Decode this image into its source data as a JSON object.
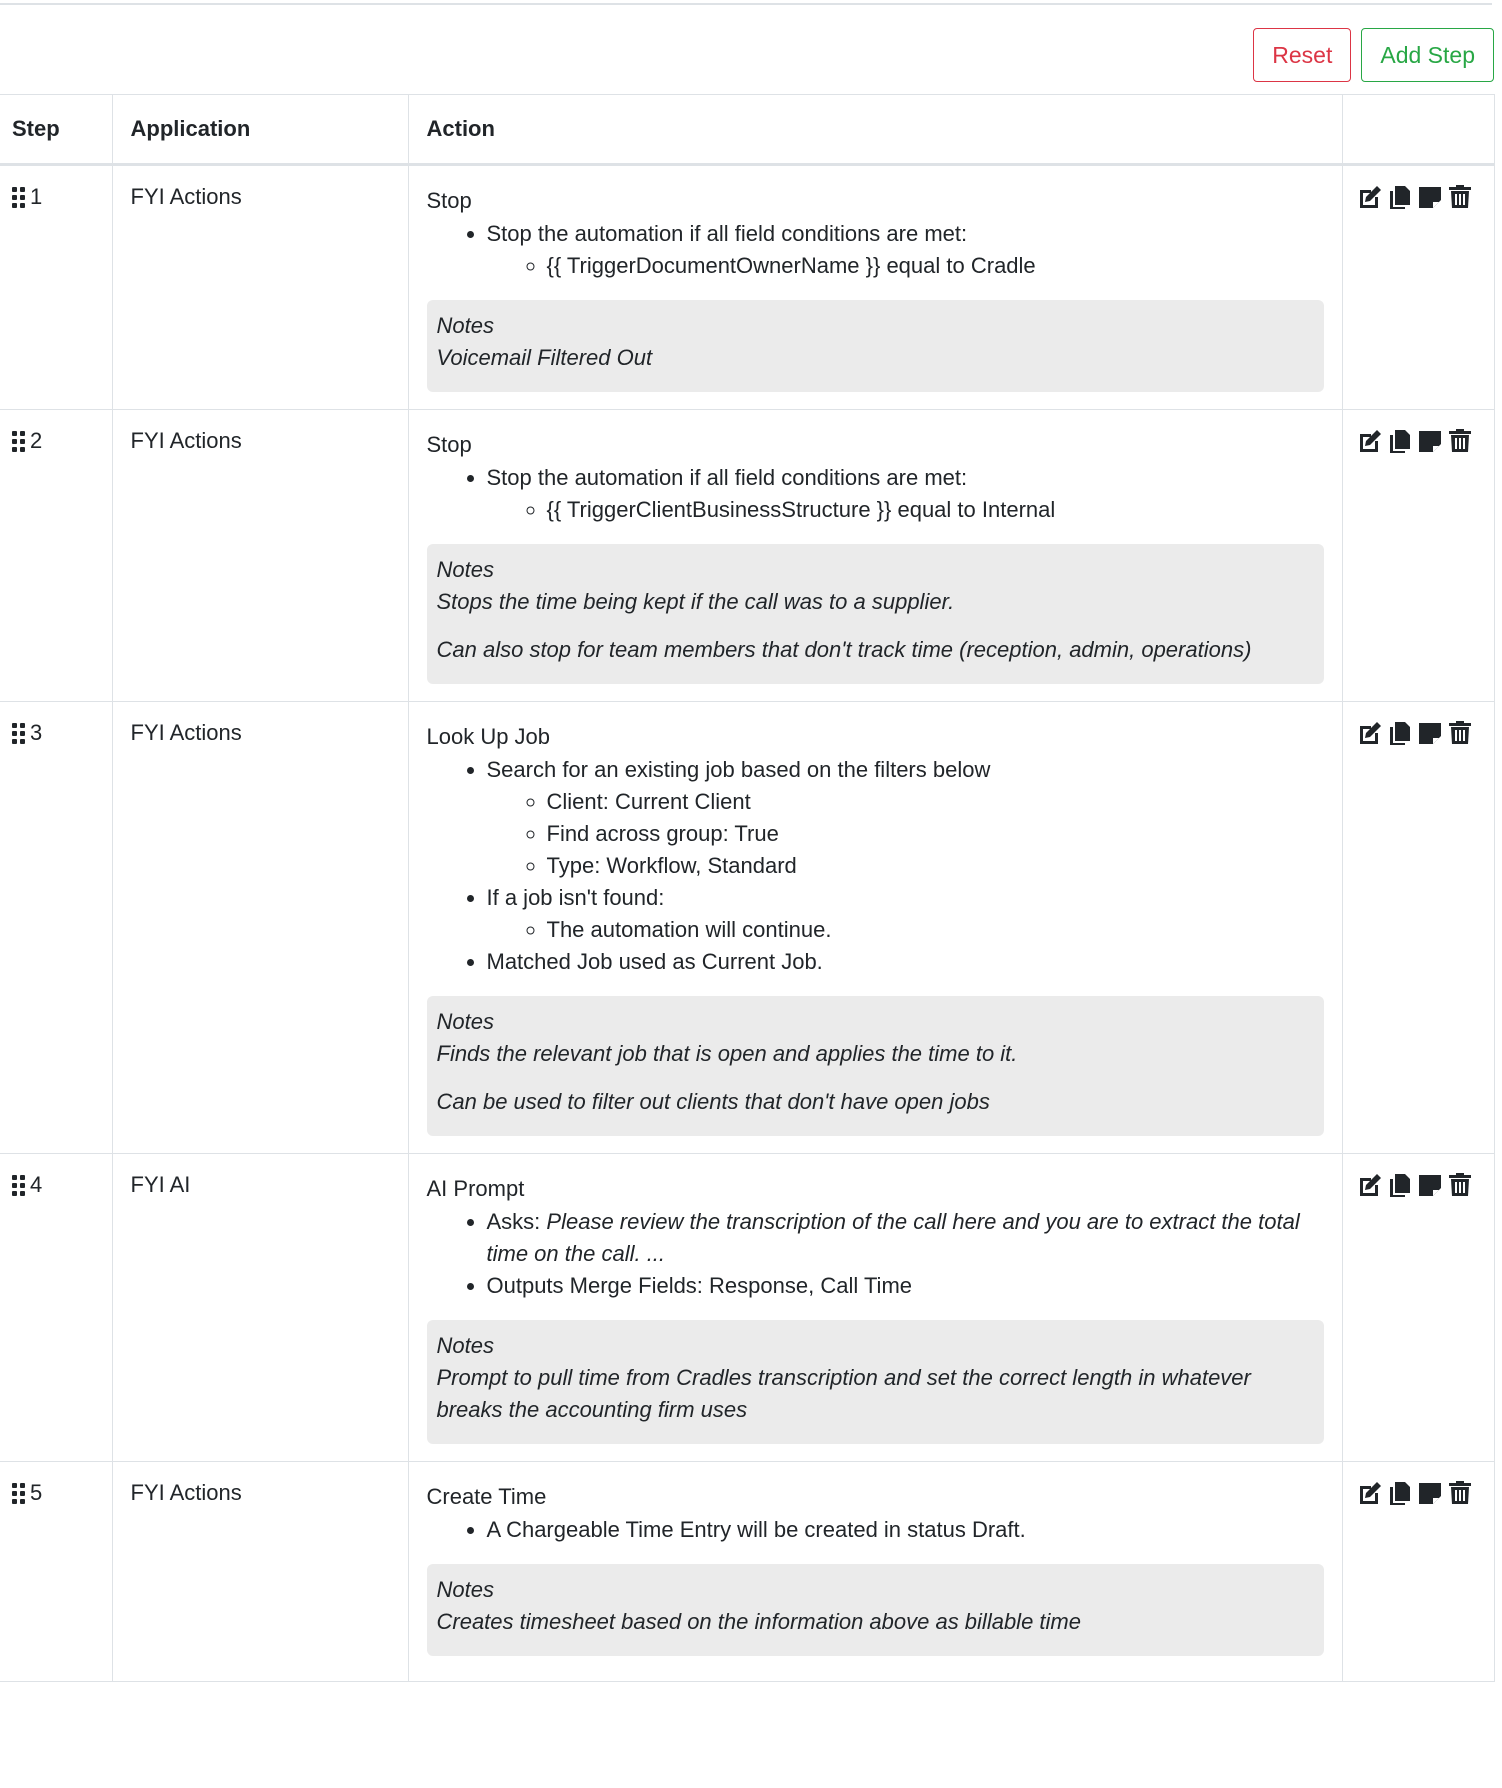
{
  "toolbar": {
    "reset_label": "Reset",
    "add_step_label": "Add Step"
  },
  "table": {
    "headers": {
      "step": "Step",
      "application": "Application",
      "action": "Action",
      "controls": ""
    }
  },
  "steps": [
    {
      "number": "1",
      "application": "FYI Actions",
      "title": "Stop",
      "b1": "Stop the automation if all field conditions are met:",
      "b1s1": "{{ TriggerDocumentOwnerName }} equal to Cradle",
      "notes_label": "Notes",
      "note1": "Voicemail Filtered Out"
    },
    {
      "number": "2",
      "application": "FYI Actions",
      "title": "Stop",
      "b1": "Stop the automation if all field conditions are met:",
      "b1s1": "{{ TriggerClientBusinessStructure }} equal to Internal",
      "notes_label": "Notes",
      "note1": "Stops the time being kept if the call was to a supplier.",
      "note2": "Can also stop for team members that don't track time (reception, admin, operations)"
    },
    {
      "number": "3",
      "application": "FYI Actions",
      "title": "Look Up Job",
      "b1": "Search for an existing job based on the filters below",
      "b1s1": "Client: Current Client",
      "b1s2": "Find across group: True",
      "b1s3": "Type: Workflow, Standard",
      "b2": "If a job isn't found:",
      "b2s1": "The automation will continue.",
      "b3": "Matched Job used as Current Job.",
      "notes_label": "Notes",
      "note1": "Finds the relevant job that is open and applies the time to it.",
      "note2": "Can be used to filter out clients that don't have open jobs"
    },
    {
      "number": "4",
      "application": "FYI AI",
      "title": "AI Prompt",
      "b1_label": "Asks: ",
      "b1_prompt": "Please review the transcription of the call here and you are to extract the total time on the call. ...",
      "b2": "Outputs Merge Fields: Response, Call Time",
      "notes_label": "Notes",
      "note1": "Prompt to pull time from Cradles transcription and set the correct length in whatever breaks the accounting firm uses"
    },
    {
      "number": "5",
      "application": "FYI Actions",
      "title": "Create Time",
      "b1": "A Chargeable Time Entry will be created in status Draft.",
      "notes_label": "Notes",
      "note1": "Creates timesheet based on the information above as billable time"
    }
  ],
  "row_icons": [
    "edit-icon",
    "copy-icon",
    "note-icon",
    "delete-icon"
  ]
}
